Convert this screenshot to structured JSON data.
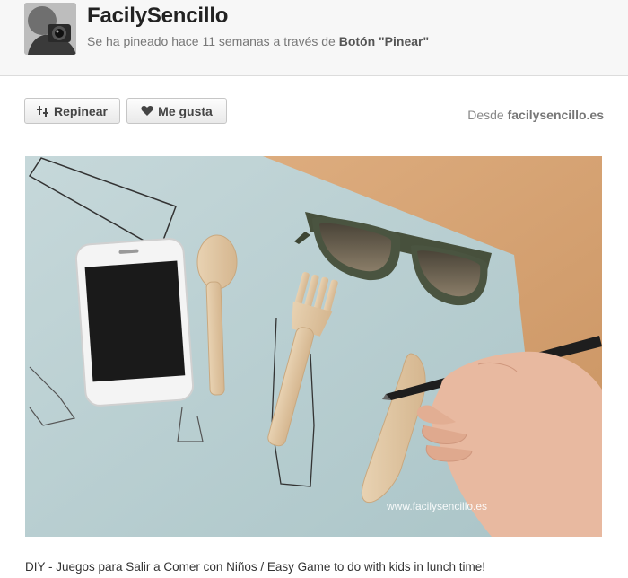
{
  "pin": {
    "username": "FacilySencillo",
    "pinned_text": "Se ha pineado hace 11 semanas a través de",
    "pinned_via": "Botón \"Pinear\""
  },
  "actions": {
    "repin_label": "Repinear",
    "like_label": "Me gusta",
    "source_prefix": "Desde",
    "source_domain": "facilysencillo.es"
  },
  "image": {
    "watermark": "www.facilysencillo.es"
  },
  "description": "DIY - Juegos para Salir a Comer con Niños / Easy Game to do with kids in lunch time!",
  "icons": {
    "repin": "pushpin-icon",
    "like": "heart-icon"
  },
  "colors": {
    "header_bg": "#f7f7f7",
    "placemat": "#b9d0d2",
    "table_wood": "#d9a878"
  }
}
